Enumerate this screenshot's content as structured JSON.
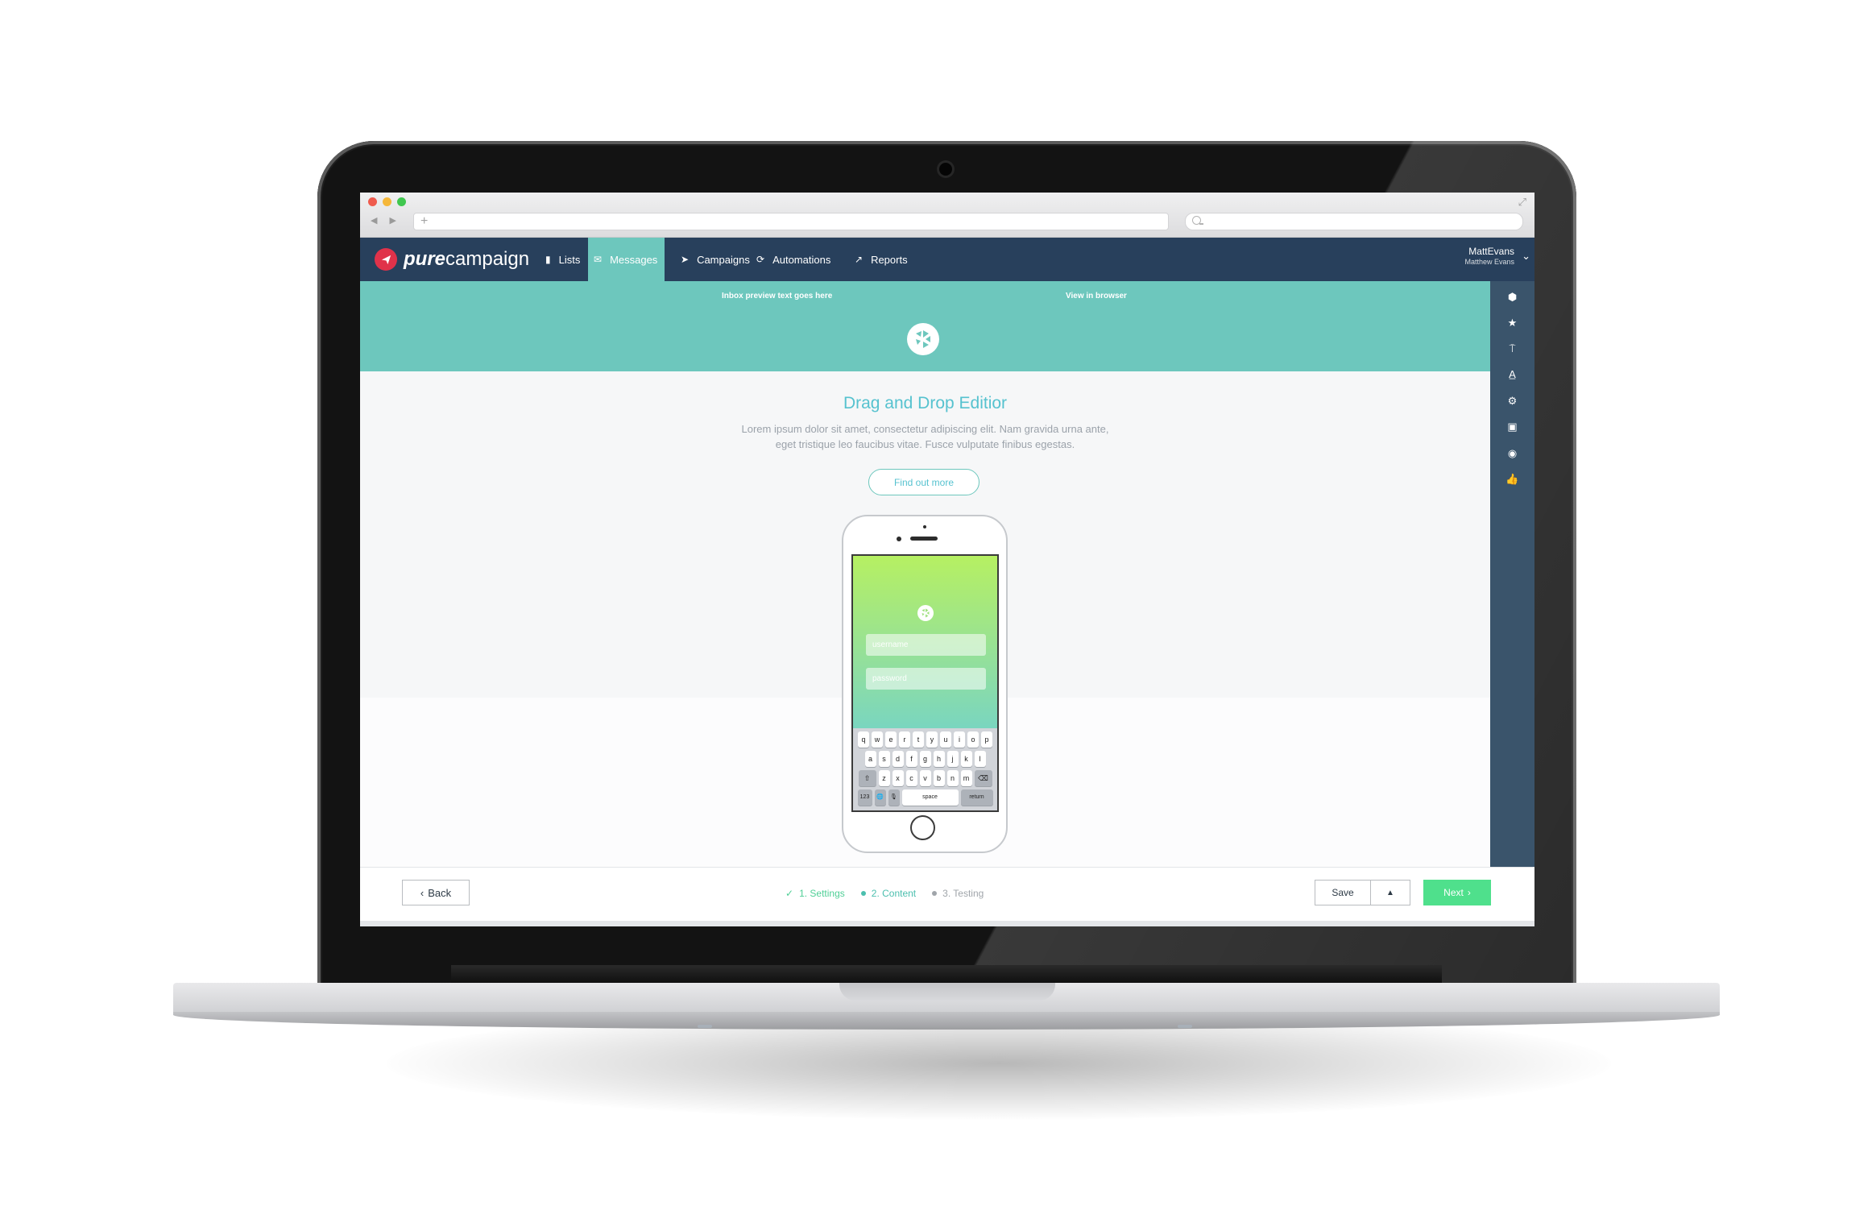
{
  "browser": {
    "url_placeholder": "+",
    "nav_arrows": "◀ ▶",
    "traffic_lights": [
      "#ef5b4e",
      "#f5b73a",
      "#40c74f"
    ]
  },
  "app": {
    "logo": {
      "pure": "pure",
      "campaign": "campaign"
    },
    "nav": [
      {
        "label": "Lists",
        "icon": "book-icon"
      },
      {
        "label": "Messages",
        "icon": "envelope-icon",
        "active": true
      },
      {
        "label": "Campaigns",
        "icon": "paper-plane-icon"
      },
      {
        "label": "Automations",
        "icon": "refresh-icon"
      },
      {
        "label": "Reports",
        "icon": "trend-line-icon"
      }
    ],
    "user": {
      "username": "MattEvans",
      "full_name": "Matthew Evans"
    },
    "tools": [
      "cube-icon",
      "star-icon",
      "paint-roller-icon",
      "text-format-icon",
      "gear-icon",
      "image-icon",
      "eye-icon",
      "thumbs-up-icon"
    ]
  },
  "email": {
    "preview_text": "Inbox preview text goes here",
    "view_in_browser": "View in browser",
    "headline": "Drag and Drop Editior",
    "body_line1": "Lorem ipsum dolor sit amet, consectetur adipiscing elit. Nam gravida urna ante,",
    "body_line2": "eget tristique leo faucibus vitae. Fusce vulputate finibus egestas.",
    "cta": "Find out more",
    "phone": {
      "username_placeholder": "username",
      "password_placeholder": "password",
      "keyboard": {
        "row1": [
          "q",
          "w",
          "e",
          "r",
          "t",
          "y",
          "u",
          "i",
          "o",
          "p"
        ],
        "row2": [
          "a",
          "s",
          "d",
          "f",
          "g",
          "h",
          "j",
          "k",
          "l"
        ],
        "row3": [
          "z",
          "x",
          "c",
          "v",
          "b",
          "n",
          "m"
        ],
        "shift": "⇧",
        "backspace": "⌫",
        "numbers": "123",
        "globe": "🌐",
        "mic": "🎙",
        "space": "space",
        "return": "return"
      }
    }
  },
  "footer": {
    "back": "Back",
    "back_icon": "‹",
    "steps": [
      {
        "label": "1. Settings",
        "state": "done"
      },
      {
        "label": "2. Content",
        "state": "current"
      },
      {
        "label": "3. Testing",
        "state": "pending"
      }
    ],
    "save": "Save",
    "save_menu": "▲",
    "next": "Next",
    "next_icon": "›"
  },
  "colors": {
    "navbar": "#28405c",
    "accent_teal": "#6dc7bd",
    "headline": "#56c2cf",
    "next_green": "#4fe08c",
    "logo_red": "#e0324a"
  }
}
